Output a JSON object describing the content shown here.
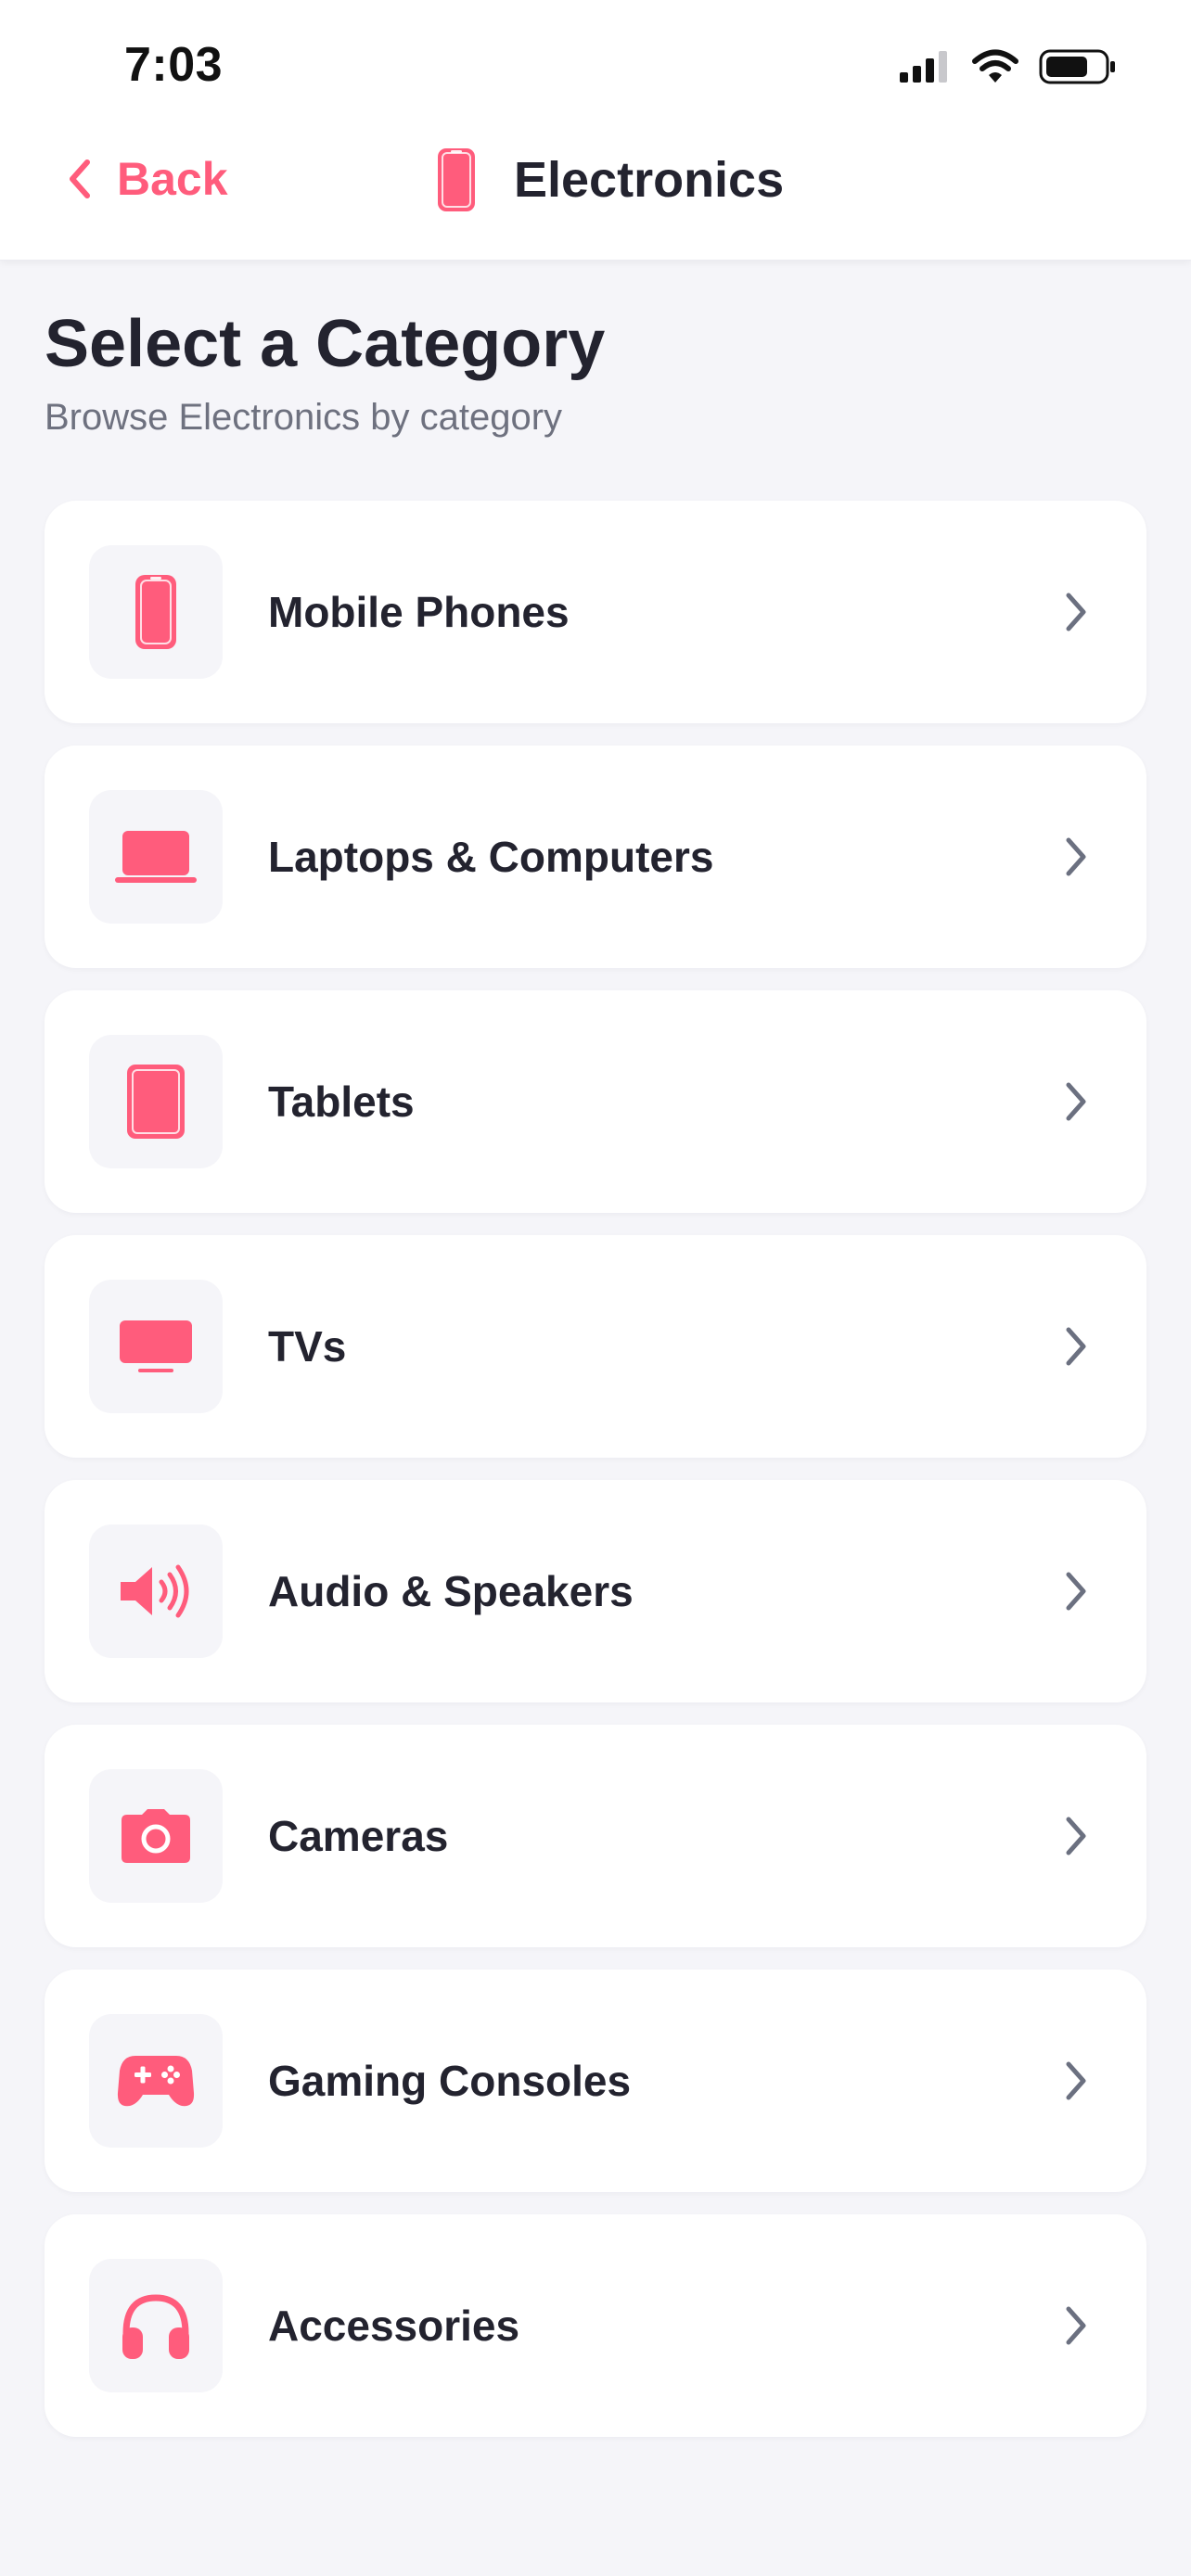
{
  "status_bar": {
    "time": "7:03"
  },
  "header": {
    "back_label": "Back",
    "title": "Electronics",
    "title_icon": "phone-icon"
  },
  "page": {
    "title": "Select a Category",
    "subtitle": "Browse Electronics by category"
  },
  "categories": [
    {
      "label": "Mobile Phones",
      "icon": "phone-icon"
    },
    {
      "label": "Laptops & Computers",
      "icon": "laptop-icon"
    },
    {
      "label": "Tablets",
      "icon": "tablet-icon"
    },
    {
      "label": "TVs",
      "icon": "tv-icon"
    },
    {
      "label": "Audio & Speakers",
      "icon": "speaker-icon"
    },
    {
      "label": "Cameras",
      "icon": "camera-icon"
    },
    {
      "label": "Gaming Consoles",
      "icon": "gamepad-icon"
    },
    {
      "label": "Accessories",
      "icon": "headphones-icon"
    }
  ],
  "colors": {
    "accent": "#ff5c7c",
    "background": "#f5f5f9",
    "card": "#ffffff",
    "text": "#23232f",
    "subtext": "#6e717f",
    "chevron": "#6b7080"
  }
}
